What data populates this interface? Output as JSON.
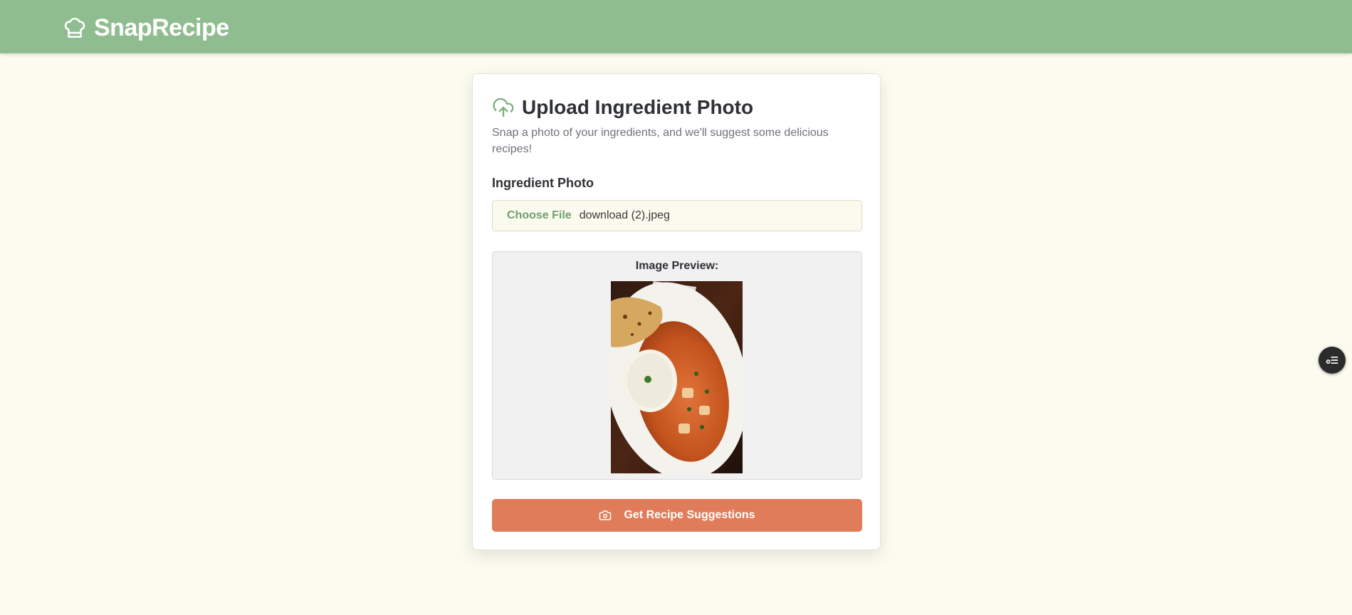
{
  "header": {
    "brand_name": "SnapRecipe",
    "brand_icon": "chef-hat-icon",
    "background": "#8fbd8f"
  },
  "card": {
    "title": "Upload Ingredient Photo",
    "title_icon": "cloud-upload-icon",
    "description": "Snap a photo of your ingredients, and we'll suggest some delicious recipes!",
    "field_label": "Ingredient Photo",
    "file_input": {
      "button_label": "Choose File",
      "file_name": "download (2).jpeg"
    },
    "preview": {
      "label": "Image Preview:",
      "image_alt": "Curry with rice and naan on a white plate"
    },
    "submit": {
      "label": "Get Recipe Suggestions",
      "icon": "camera-icon",
      "color": "#e07c5a"
    }
  },
  "floating_button": {
    "icon": "list-settings-icon"
  },
  "colors": {
    "accent": "#8fbd8f",
    "page_background": "#fbfbef",
    "cta": "#e07c5a"
  }
}
